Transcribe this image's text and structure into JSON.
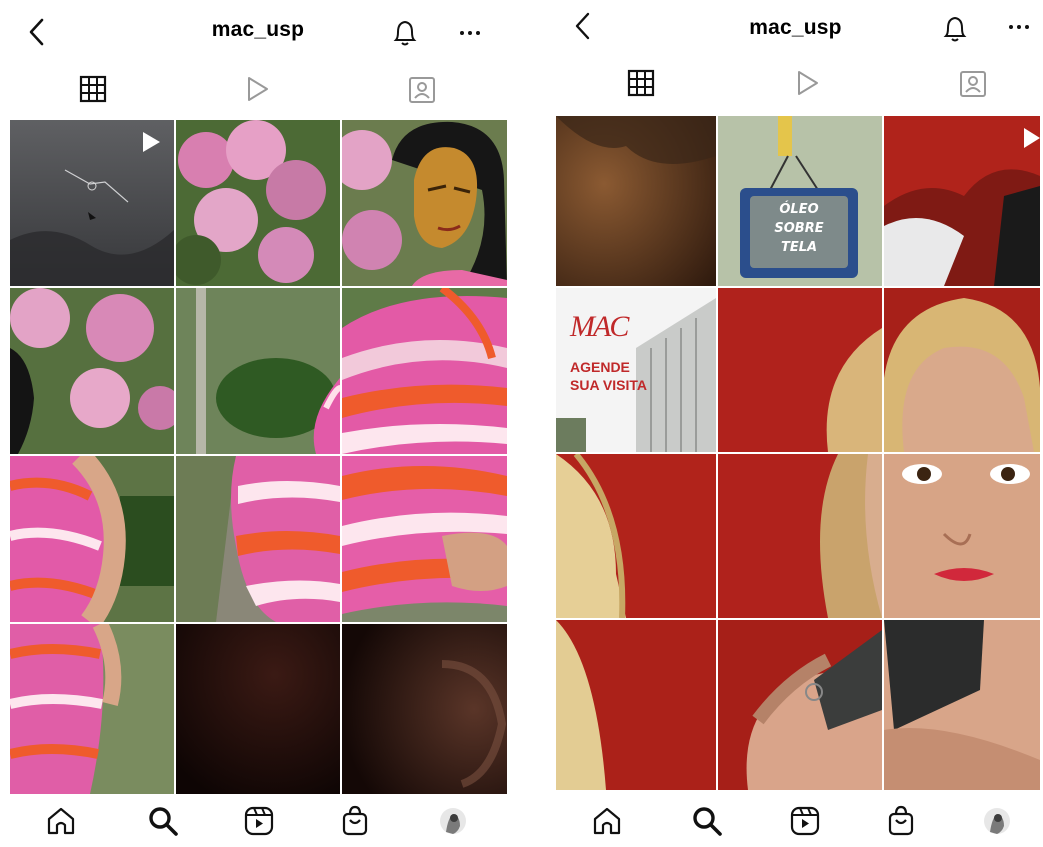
{
  "screens": [
    {
      "header": {
        "username": "mac_usp"
      },
      "tabs": [
        {
          "name": "grid",
          "icon": "grid-icon",
          "active": true
        },
        {
          "name": "reels",
          "icon": "play-icon",
          "active": false
        },
        {
          "name": "tagged",
          "icon": "tagged-icon",
          "active": false
        }
      ],
      "bottom_nav": [
        "home-icon",
        "search-icon",
        "reels-icon",
        "shop-icon",
        "profile-avatar"
      ]
    },
    {
      "header": {
        "username": "mac_usp"
      },
      "tabs": [
        {
          "name": "grid",
          "icon": "grid-icon",
          "active": true
        },
        {
          "name": "reels",
          "icon": "play-icon",
          "active": false
        },
        {
          "name": "tagged",
          "icon": "tagged-icon",
          "active": false
        }
      ],
      "posts_text": {
        "tv_caption": [
          "ÓLEO",
          "SOBRE",
          "TELA"
        ],
        "mac_logo": "MAC",
        "mac_caption": [
          "AGENDE",
          "SUA VISITA"
        ]
      },
      "bottom_nav": [
        "home-icon",
        "search-icon",
        "reels-icon",
        "shop-icon",
        "profile-avatar"
      ]
    }
  ],
  "colors": {
    "accent_red": "#c0292a",
    "pink_dress": "#e24aa3",
    "orange_dress": "#ef5a2c",
    "foliage": "#4f6b3a",
    "bg": "#ffffff"
  }
}
